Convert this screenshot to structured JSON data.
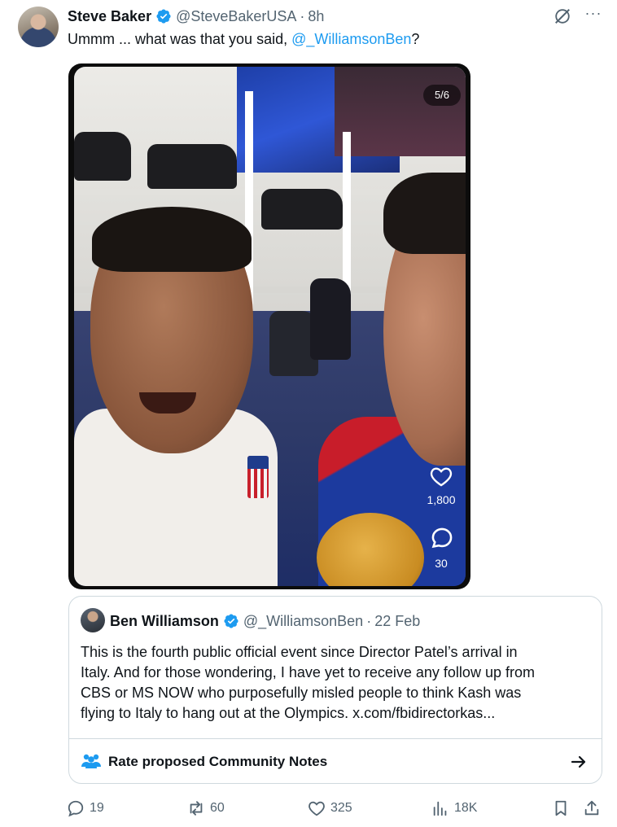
{
  "tweet": {
    "author_name": "Steve Baker",
    "author_handle": "@SteveBakerUSA",
    "separator": "·",
    "time": "8h",
    "text_before": "Ummm ... what was that you said, ",
    "mention": "@_WilliamsonBen",
    "text_after": "?",
    "more_label": "···"
  },
  "media": {
    "page_indicator": "5/6",
    "likes": "1,800",
    "comments": "30"
  },
  "quote": {
    "author_name": "Ben Williamson",
    "author_handle": "@_WilliamsonBen",
    "separator": "·",
    "date": "22 Feb",
    "text": "This is the fourth public official event since Director Patel’s arrival in\nItaly. And for those wondering, I have yet to receive any follow up from\nCBS or MS NOW who purposefully misled people to think Kash was\nflying to Italy to hang out at the Olympics. x.com/fbidirectorkas...",
    "community_notes_label": "Rate proposed Community Notes"
  },
  "actions": {
    "replies": "19",
    "reposts": "60",
    "likes": "325",
    "views": "18K"
  },
  "colors": {
    "accent": "#1d9bf0",
    "muted_text": "#536471",
    "border": "#cfd9de"
  },
  "icons": [
    "verified-badge-icon",
    "grok-icon",
    "more-icon",
    "heart-icon",
    "comment-icon",
    "community-notes-icon",
    "arrow-right-icon",
    "reply-icon",
    "repost-icon",
    "like-icon",
    "views-icon",
    "bookmark-icon",
    "share-icon"
  ]
}
